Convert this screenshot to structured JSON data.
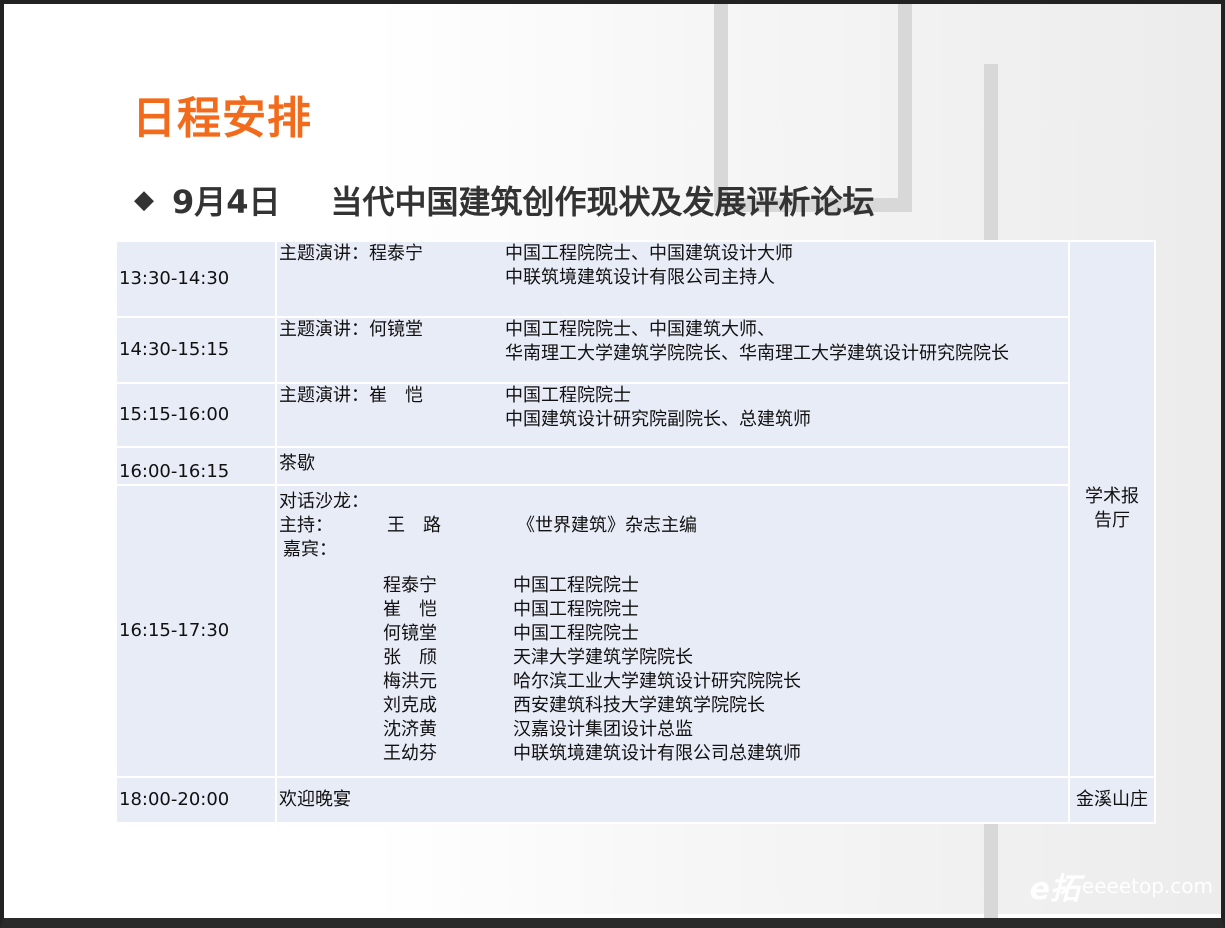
{
  "title": "日程安排",
  "subtitle": {
    "date": "9月4日",
    "forum": "当代中国建筑创作现状及发展评析论坛"
  },
  "rows": [
    {
      "time": "13:30-14:30",
      "label": "主题演讲：程泰宁",
      "lines": [
        "中国工程院院士、中国建筑设计大师",
        "中联筑境建筑设计有限公司主持人"
      ]
    },
    {
      "time": "14:30-15:15",
      "label": "主题演讲：何镜堂",
      "lines": [
        "中国工程院院士、中国建筑大师、",
        "华南理工大学建筑学院院长、华南理工大学建筑设计研究院院长"
      ]
    },
    {
      "time": "15:15-16:00",
      "label": "主题演讲：崔　恺",
      "lines": [
        "中国工程院院士",
        "中国建筑设计研究院副院长、总建筑师"
      ]
    },
    {
      "time": "16:00-16:15",
      "label": "茶歇"
    }
  ],
  "salon": {
    "time": "16:15-17:30",
    "heading": "对话沙龙：",
    "host_label": "主持：",
    "host_name": "王　路",
    "host_desc": "《世界建筑》杂志主编",
    "guests_label": "嘉宾：",
    "guests": [
      {
        "name": "程泰宁",
        "desc": "中国工程院院士"
      },
      {
        "name": "崔　恺",
        "desc": "中国工程院院士"
      },
      {
        "name": "何镜堂",
        "desc": "中国工程院院士"
      },
      {
        "name": "张　颀",
        "desc": "天津大学建筑学院院长"
      },
      {
        "name": "梅洪元",
        "desc": "哈尔滨工业大学建筑设计研究院院长"
      },
      {
        "name": "刘克成",
        "desc": "西安建筑科技大学建筑学院院长"
      },
      {
        "name": "沈济黄",
        "desc": "汉嘉设计集团设计总监"
      },
      {
        "name": "王幼芬",
        "desc": "中联筑境建筑设计有限公司总建筑师"
      }
    ]
  },
  "venue_main": "学术报告厅",
  "dinner": {
    "time": "18:00-20:00",
    "label": "欢迎晚宴",
    "venue": "金溪山庄"
  },
  "watermark": {
    "mark": "e拓",
    "site": "eeeetop.com"
  },
  "colors": {
    "title": "#f26b1d",
    "cell": "#e8ecf7"
  }
}
